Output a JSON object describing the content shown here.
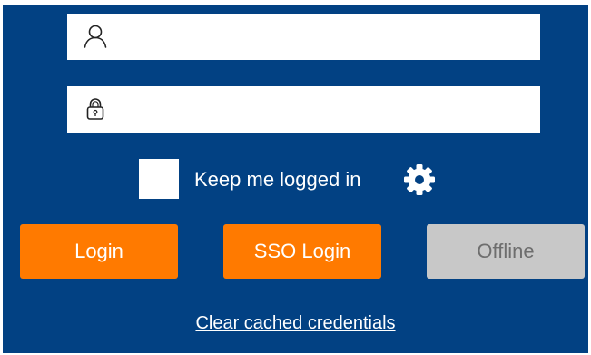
{
  "form": {
    "username": {
      "value": "",
      "placeholder": ""
    },
    "password": {
      "value": "",
      "placeholder": ""
    },
    "keep_logged_in": {
      "label": "Keep me logged in",
      "checked": false
    }
  },
  "buttons": {
    "login": "Login",
    "sso_login": "SSO Login",
    "offline": "Offline"
  },
  "links": {
    "clear_cached_credentials": "Clear cached credentials"
  },
  "icons": {
    "username": "user-icon",
    "password": "padlock-icon",
    "settings": "gear-icon"
  },
  "colors": {
    "background": "#024183",
    "primary_button": "#ff7a00",
    "disabled_button": "#c8c8c8",
    "disabled_text": "#6e6e6e",
    "text_on_dark": "#ffffff"
  }
}
